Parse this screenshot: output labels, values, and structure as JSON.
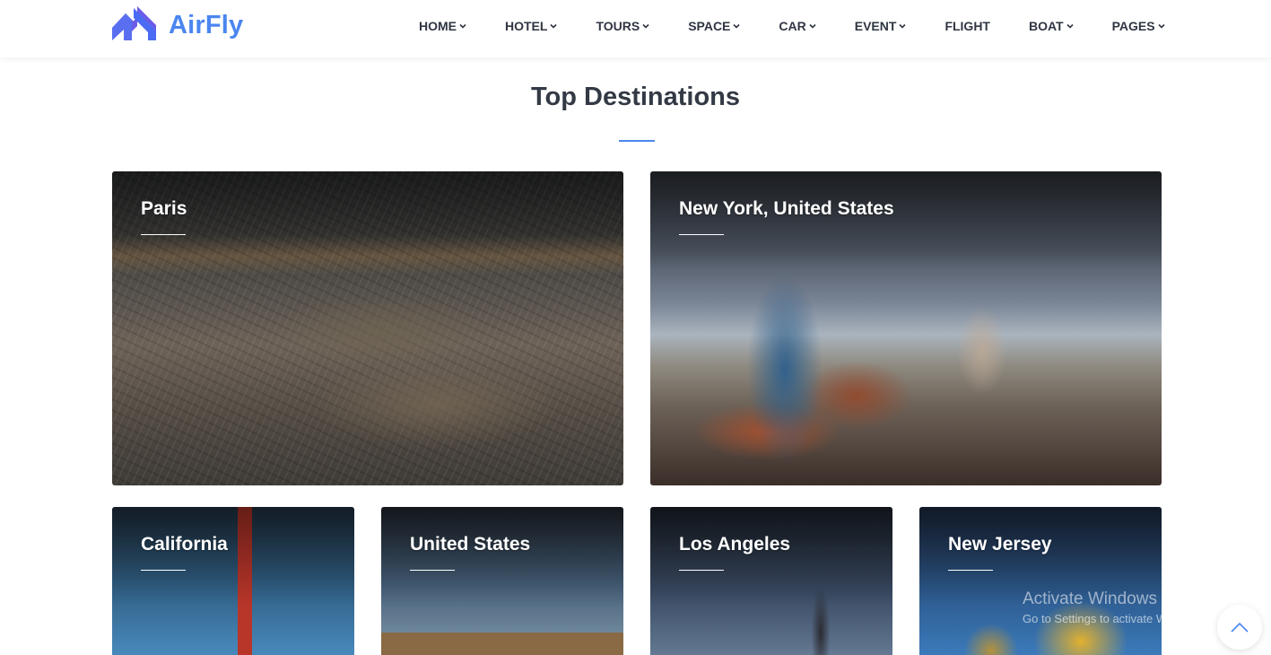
{
  "brand": {
    "name": "AirFly",
    "accent_color": "#4a86f0",
    "logo_icon": "airfly-logo-icon"
  },
  "nav": {
    "items": [
      {
        "label": "HOME",
        "has_dropdown": true
      },
      {
        "label": "HOTEL",
        "has_dropdown": true
      },
      {
        "label": "TOURS",
        "has_dropdown": true
      },
      {
        "label": "SPACE",
        "has_dropdown": true
      },
      {
        "label": "CAR",
        "has_dropdown": true
      },
      {
        "label": "EVENT",
        "has_dropdown": true
      },
      {
        "label": "FLIGHT",
        "has_dropdown": false
      },
      {
        "label": "BOAT",
        "has_dropdown": true
      },
      {
        "label": "PAGES",
        "has_dropdown": true
      }
    ]
  },
  "section": {
    "title": "Top Destinations"
  },
  "destinations": [
    {
      "name": "Paris"
    },
    {
      "name": "New York, United States"
    },
    {
      "name": "California"
    },
    {
      "name": "United States"
    },
    {
      "name": "Los Angeles"
    },
    {
      "name": "New Jersey"
    }
  ],
  "watermark": {
    "title": "Activate Windows",
    "subtitle": "Go to Settings to activate Windows."
  },
  "scroll_top": {
    "icon": "chevron-up-icon"
  }
}
